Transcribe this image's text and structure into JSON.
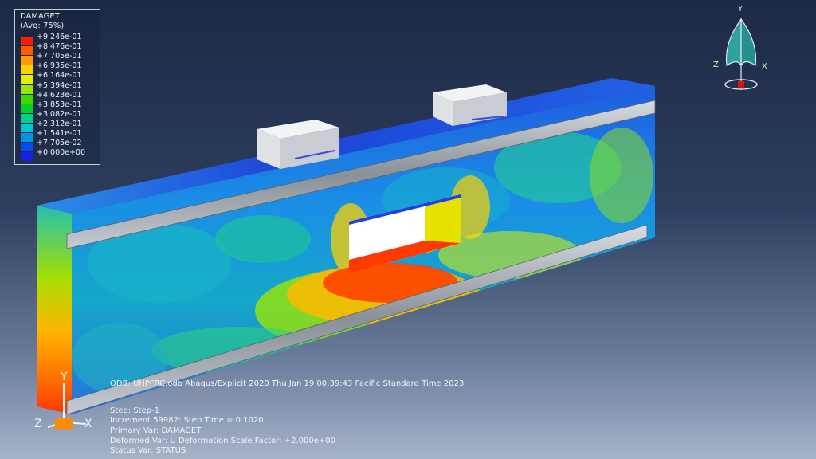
{
  "legend": {
    "title": "DAMAGET",
    "subtitle": "(Avg: 75%)",
    "items": [
      {
        "label": "+9.246e-01",
        "color": "#ff1a00"
      },
      {
        "label": "+8.476e-01",
        "color": "#ff5a00"
      },
      {
        "label": "+7.705e-01",
        "color": "#ff9a00"
      },
      {
        "label": "+6.935e-01",
        "color": "#ffd100"
      },
      {
        "label": "+6.164e-01",
        "color": "#e0f000"
      },
      {
        "label": "+5.394e-01",
        "color": "#9ae600"
      },
      {
        "label": "+4.623e-01",
        "color": "#3ed800"
      },
      {
        "label": "+3.853e-01",
        "color": "#00d42a"
      },
      {
        "label": "+3.082e-01",
        "color": "#00d08c"
      },
      {
        "label": "+2.312e-01",
        "color": "#00c6d0"
      },
      {
        "label": "+1.541e-01",
        "color": "#0094e6"
      },
      {
        "label": "+7.705e-02",
        "color": "#0050f0"
      },
      {
        "label": "+0.000e+00",
        "color": "#1a1ee0"
      }
    ]
  },
  "triad_view": {
    "y": "Y",
    "z": "Z",
    "x": "X"
  },
  "local_axes": {
    "y": "Y",
    "z": "Z",
    "x": "X"
  },
  "info": {
    "header": "ODB: UHPFRC.odb    Abaqus/Explicit 2020    Thu Jan 19 00:39:43 Pacific Standard Time 2023",
    "step": "Step: Step-1",
    "increment": "Increment     59982: Step Time =    0.1020",
    "primary_var": "Primary Var: DAMAGET",
    "deformed_var": "Deformed Var: U   Deformation Scale Factor: +2.000e+00",
    "status_var": "Status Var: STATUS"
  }
}
